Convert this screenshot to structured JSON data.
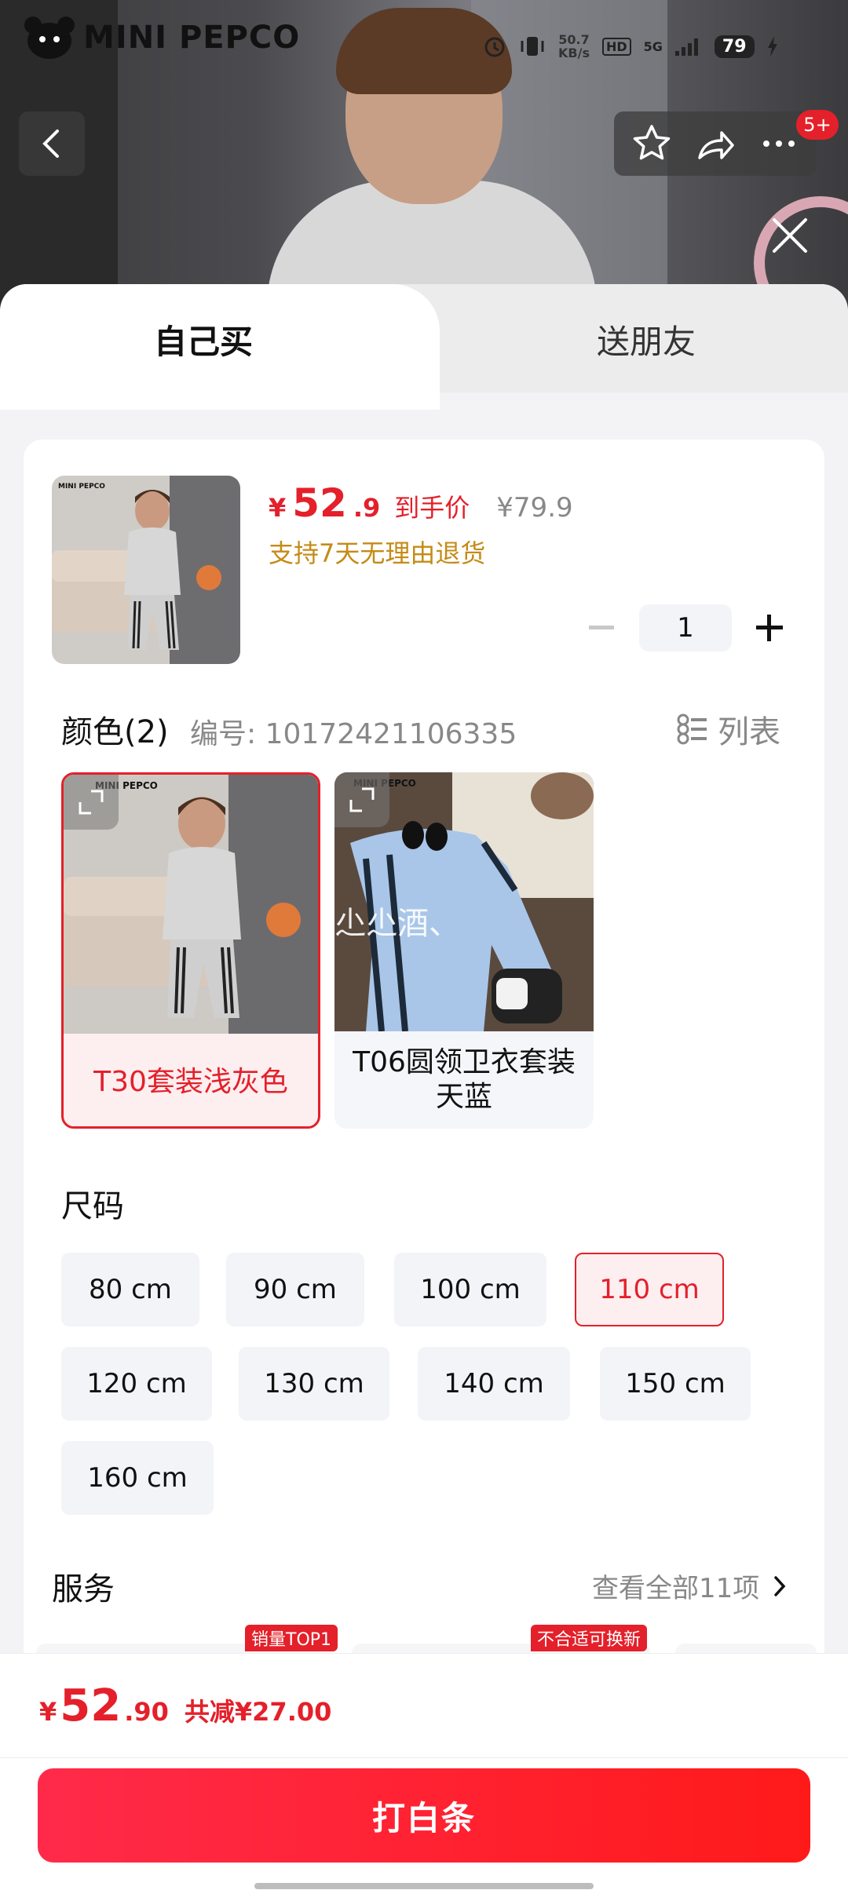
{
  "brand": {
    "logo_text": "MINI PEPCO"
  },
  "status_bar": {
    "net_speed_value": "50.7",
    "net_speed_unit": "KB/s",
    "hd": "HD",
    "signal": "5G",
    "battery": "79"
  },
  "tabs": {
    "self": "自己买",
    "gift": "送朋友"
  },
  "cart_badge": "5+",
  "product": {
    "price_symbol": "¥",
    "price_int": "52",
    "price_dec": ".9",
    "price_tag": "到手价",
    "original_price": "¥79.9",
    "return_policy": "支持7天无理由退货",
    "quantity": "1"
  },
  "color_section": {
    "title": "颜色(2)",
    "code": "编号: 10172421106335",
    "list_label": "列表",
    "options": [
      {
        "label": "T30套装浅灰色",
        "selected": true
      },
      {
        "label": "T06圆领卫衣套装天蓝",
        "selected": false,
        "watermark": "尐尐酒、"
      }
    ]
  },
  "size_section": {
    "title": "尺码",
    "options": [
      "80 cm",
      "90 cm",
      "100 cm",
      "110 cm",
      "120 cm",
      "130 cm",
      "140 cm",
      "150 cm",
      "160 cm"
    ],
    "selected": "110 cm"
  },
  "service_section": {
    "title": "服务",
    "more": "查看全部11项",
    "tags": [
      "销量TOP1",
      "不合适可换新"
    ]
  },
  "footer": {
    "price_symbol": "¥",
    "price_int": "52",
    "price_dec": ".90",
    "saving": "共减¥27.00",
    "pay_button": "打白条"
  },
  "colors": {
    "accent": "#e4202a",
    "gold": "#c58b17"
  }
}
